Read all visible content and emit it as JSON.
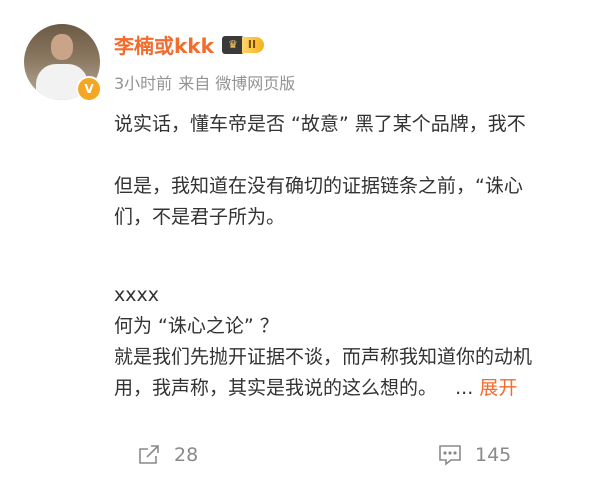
{
  "post": {
    "author": {
      "name": "李楠或kkk",
      "level": "II",
      "verified_badge": "V"
    },
    "meta": {
      "time": "3小时前",
      "source": "来自 微博网页版"
    },
    "content": {
      "line1": "说实话，懂车帝是否 “故意” 黑了某个品牌，我不",
      "line2": "但是，我知道在没有确切的证据链条之前，“诛心",
      "line3": "们，不是君子所为。",
      "line4": "xxxx",
      "line5": "何为 “诛心之论” ？",
      "line6": "就是我们先抛开证据不谈，而声称我知道你的动机",
      "line7": "用，我声称，其实是我说的这么想的。",
      "ellipsis": "...",
      "expand": "展开"
    },
    "actions": {
      "repost_count": "28",
      "comment_count": "145"
    }
  },
  "colors": {
    "accent": "#f36b2d",
    "meta": "#939393",
    "text": "#333333",
    "action": "#8a8a8a"
  }
}
